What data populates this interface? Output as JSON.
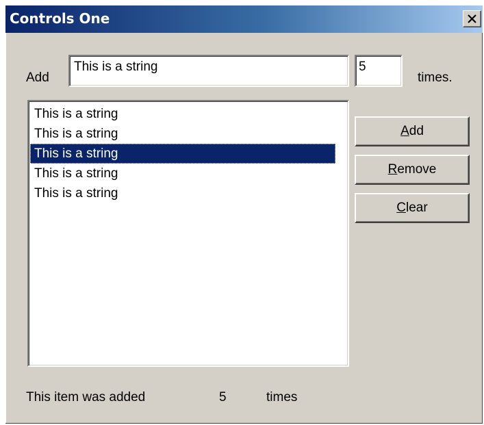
{
  "window": {
    "title": "Controls One"
  },
  "add_row": {
    "add_label": "Add",
    "string_value": "This is a string",
    "count_value": "5",
    "times_label": "times."
  },
  "list": {
    "items": [
      "This is a string",
      "This is a string",
      "This is a string",
      "This is a string",
      "This is a string"
    ],
    "selected_index": 2
  },
  "buttons": {
    "add": {
      "mnemonic": "A",
      "rest": "dd"
    },
    "remove": {
      "mnemonic": "R",
      "rest": "emove"
    },
    "clear": {
      "mnemonic": "C",
      "rest": "lear"
    }
  },
  "status": {
    "prefix": "This item was added",
    "count": "5",
    "suffix": "times"
  },
  "colors": {
    "title_active": "#0a246a",
    "title_gradient_end": "#a6caf0",
    "dialog_face": "#d4d0c8",
    "selection": "#0a246a"
  }
}
